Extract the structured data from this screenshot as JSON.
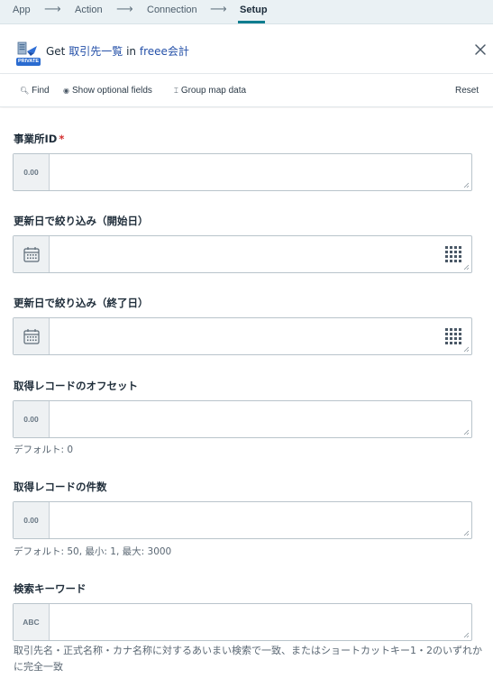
{
  "steps": [
    {
      "label": "App"
    },
    {
      "label": "Action"
    },
    {
      "label": "Connection"
    },
    {
      "label": "Setup"
    }
  ],
  "header": {
    "badge": "PRIVATE",
    "title_prefix": "Get",
    "title_object": "取引先一覧",
    "title_in": "in",
    "title_app": "freee会計"
  },
  "toolbar": {
    "find": "Find",
    "show_optional": "Show optional fields",
    "group_map": "Group map data",
    "reset": "Reset"
  },
  "fields": [
    {
      "label": "事業所ID",
      "required_mark": "*",
      "prefix": "0.00",
      "value": ""
    },
    {
      "label": "更新日で絞り込み（開始日）",
      "value": ""
    },
    {
      "label": "更新日で絞り込み（終了日）",
      "value": ""
    },
    {
      "label": "取得レコードのオフセット",
      "prefix": "0.00",
      "hint": "デフォルト: 0",
      "value": ""
    },
    {
      "label": "取得レコードの件数",
      "prefix": "0.00",
      "hint": "デフォルト: 50, 最小: 1, 最大: 3000",
      "value": ""
    },
    {
      "label": "検索キーワード",
      "prefix": "ABC",
      "hint": "取引先名・正式名称・カナ名称に対するあいまい検索で一致、またはショートカットキー1・2のいずれかに完全一致",
      "value": ""
    }
  ]
}
